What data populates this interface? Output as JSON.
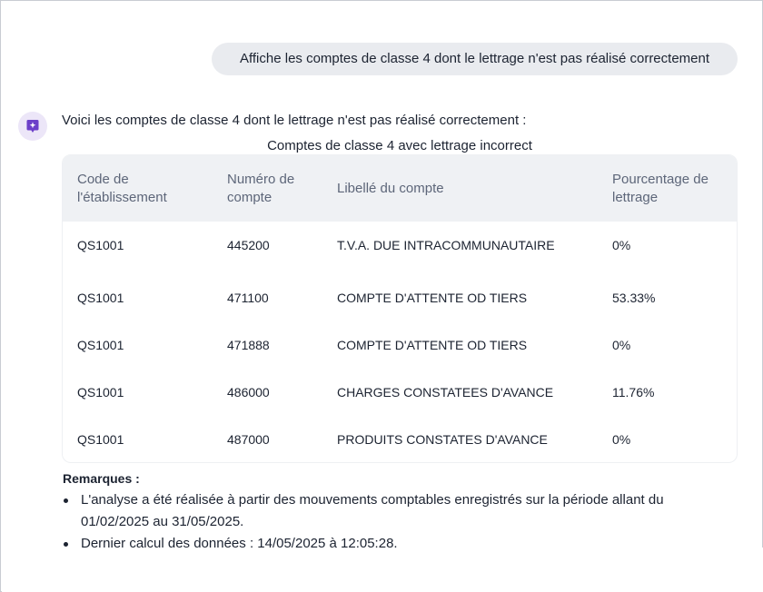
{
  "conversation": {
    "user_message": "Affiche les comptes de classe 4 dont le lettrage n'est pas réalisé correctement",
    "assistant_intro": "Voici les comptes de classe 4 dont le lettrage n'est pas réalisé correctement :"
  },
  "table": {
    "caption": "Comptes de classe 4 avec lettrage incorrect",
    "headers": {
      "code": [
        "Code de",
        "l'établissement"
      ],
      "numero": [
        "Numéro de",
        "compte"
      ],
      "libelle": [
        "Libellé du compte"
      ],
      "pourcentage": [
        "Pourcentage de",
        "lettrage"
      ]
    },
    "rows": [
      {
        "code": "QS1001",
        "numero": "445200",
        "libelle": "T.V.A. DUE INTRACOMMUNAUTAIRE",
        "pourcentage": "0%"
      },
      {
        "code": "QS1001",
        "numero": "471100",
        "libelle": "COMPTE D'ATTENTE OD TIERS",
        "pourcentage": "53.33%"
      },
      {
        "code": "QS1001",
        "numero": "471888",
        "libelle": "COMPTE D'ATTENTE OD TIERS",
        "pourcentage": "0%"
      },
      {
        "code": "QS1001",
        "numero": "486000",
        "libelle": "CHARGES CONSTATEES D'AVANCE",
        "pourcentage": "11.76%"
      },
      {
        "code": "QS1001",
        "numero": "487000",
        "libelle": "PRODUITS CONSTATES D'AVANCE",
        "pourcentage": "0%"
      }
    ]
  },
  "remarks": {
    "title": "Remarques :",
    "items": [
      "L'analyse a été réalisée à partir des mouvements comptables enregistrés sur la période allant du 01/02/2025 au 31/05/2025.",
      "Dernier calcul des données : 14/05/2025 à 12:05:28."
    ]
  },
  "icons": {
    "assistant_avatar": "sparkle-bubble-icon"
  },
  "colors": {
    "accent": "#6c3fc9",
    "avatar_bg": "#ece6f8",
    "user_bubble": "#e9ebef",
    "table_header": "#eff1f4"
  }
}
